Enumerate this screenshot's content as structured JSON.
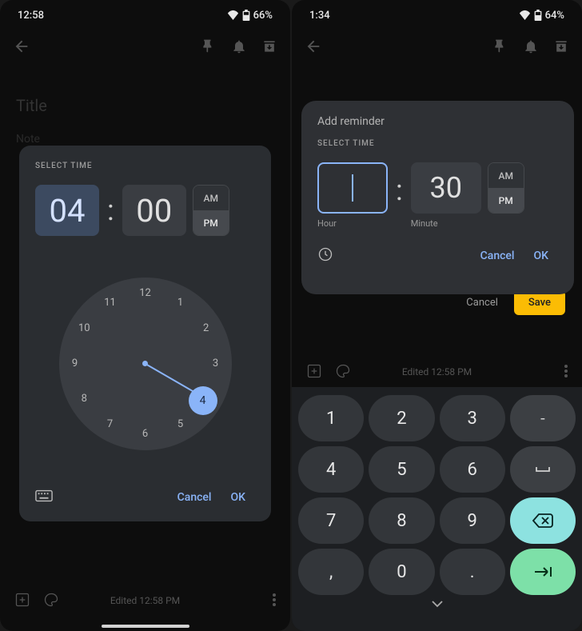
{
  "left": {
    "status": {
      "time": "12:58",
      "battery": "66%"
    },
    "bg": {
      "title": "Title",
      "note": "Note"
    },
    "dialog": {
      "label": "SELECT TIME",
      "hour": "04",
      "minute": "00",
      "am": "AM",
      "pm": "PM",
      "selected_period": "PM",
      "clock_numbers": [
        "12",
        "1",
        "2",
        "3",
        "4",
        "5",
        "6",
        "7",
        "8",
        "9",
        "10",
        "11"
      ],
      "selected_hour_on_clock": "4",
      "cancel": "Cancel",
      "ok": "OK"
    },
    "bottom": {
      "edited": "Edited 12:58 PM"
    }
  },
  "right": {
    "status": {
      "time": "1:34",
      "battery": "64%"
    },
    "under_dialog": {
      "cancel": "Cancel",
      "save": "Save"
    },
    "dialog": {
      "title": "Add reminder",
      "label": "SELECT TIME",
      "hour": "",
      "minute": "30",
      "hour_label": "Hour",
      "minute_label": "Minute",
      "am": "AM",
      "pm": "PM",
      "selected_period": "PM",
      "cancel": "Cancel",
      "ok": "OK"
    },
    "bottom": {
      "edited": "Edited 12:58 PM"
    },
    "keypad": {
      "keys": [
        "1",
        "2",
        "3",
        "-",
        "4",
        "5",
        "6",
        "␣",
        "7",
        "8",
        "9",
        "⌫",
        ",",
        "0",
        ".",
        "⇥"
      ]
    }
  }
}
